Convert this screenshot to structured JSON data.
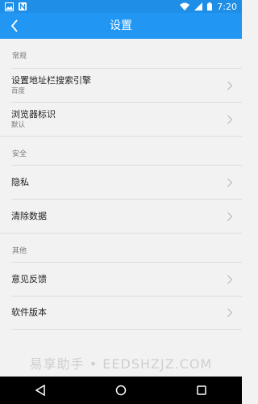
{
  "status_bar": {
    "time": "7:20",
    "icons": [
      "image-icon",
      "n-icon",
      "wifi-icon",
      "signal-icon",
      "battery-icon"
    ]
  },
  "app_bar": {
    "title": "设置",
    "back_icon": "back-arrow-icon"
  },
  "sections": [
    {
      "header": "常规",
      "items": [
        {
          "title": "设置地址栏搜索引擎",
          "subtitle": "百度"
        },
        {
          "title": "浏览器标识",
          "subtitle": "默认"
        }
      ]
    },
    {
      "header": "安全",
      "items": [
        {
          "title": "隐私"
        },
        {
          "title": "清除数据"
        }
      ]
    },
    {
      "header": "其他",
      "items": [
        {
          "title": "意见反馈"
        },
        {
          "title": "软件版本"
        }
      ]
    }
  ],
  "watermark": "易享助手 • EEDSHZJZ.COM",
  "nav_bar": {
    "buttons": [
      "back-triangle-icon",
      "home-circle-icon",
      "recents-square-icon"
    ]
  },
  "colors": {
    "primary": "#2196f3",
    "status_bar": "#1f8ee6",
    "background": "#f2f2f2"
  }
}
